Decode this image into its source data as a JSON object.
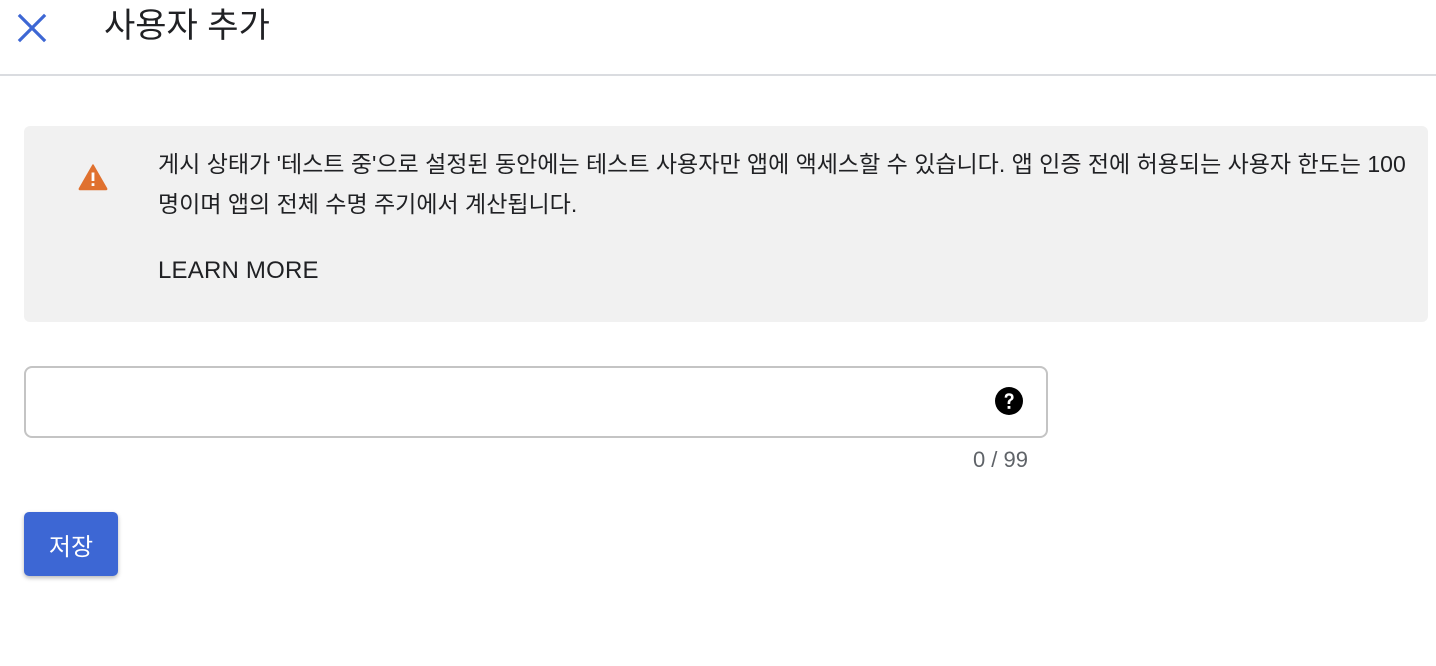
{
  "header": {
    "title": "사용자 추가",
    "close_icon": "close-icon"
  },
  "notice": {
    "icon": "warning-icon",
    "text": "게시 상태가 '테스트 중'으로 설정된 동안에는 테스트 사용자만 앱에 액세스할 수 있습니다. 앱 인증 전에 허용되는 사용자 한도는 100명이며 앱의 전체 수명 주기에서 계산됩니다.",
    "learn_more": "LEARN MORE"
  },
  "user_field": {
    "value": "",
    "placeholder": "",
    "help_icon": "help-icon",
    "counter": "0 / 99"
  },
  "actions": {
    "save_label": "저장"
  },
  "colors": {
    "accent": "#3d67d4",
    "warning": "#e0712f",
    "notice_bg": "#f1f1f1"
  }
}
